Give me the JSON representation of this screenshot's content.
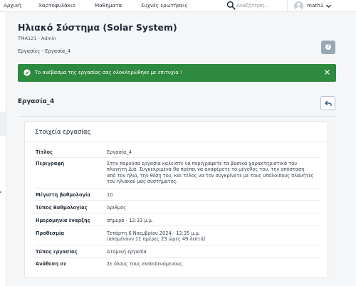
{
  "topnav": {
    "items": [
      "Αρχική",
      "Χαρτοφυλάκιο",
      "Μαθήματα",
      "Συχνές ερωτήσεις"
    ],
    "search_placeholder": "Αναζήτηση...",
    "username": "math1"
  },
  "header": {
    "title": "Ηλιακό Σύστημα (Solar System)",
    "course_sub": "TMA121 - Admin",
    "breadcrumb": "Εργασίες - Εργασία_4"
  },
  "alert": {
    "message": "Το ανέβασμα της εργασίας σας ολοκληρώθηκε με επιτυχία !",
    "color": "#2e8a3e"
  },
  "assignment": {
    "heading": "Εργασία_4"
  },
  "details": {
    "title": "Στοιχεία εργασίας",
    "rows": [
      {
        "label": "Τίτλος",
        "value": "Εργασία_4"
      },
      {
        "label": "Περιγραφή",
        "value_lines": [
          "Στην παρούσα εργασία καλείστε να περιγράψετε τα βασικά χαρακτηριστικά του",
          "πλανήτη Δία. Συγκεκριμένα θα πρέπει να αναφέρετε το μέγεθος του, την απόσταση",
          "από τον ήλιο, την θέση του, και τέλος να τον συγκρίνετε με τους υπόλοιπους πλανήτες",
          "του ηλιακού μας συστήματος."
        ]
      },
      {
        "label": "Μέγιστη βαθμολογία",
        "value": "10"
      },
      {
        "label": "Τύπος Βαθμολογίας",
        "value": "Αριθμός"
      },
      {
        "label": "Ημερομηνία έναρξης",
        "value": "σήμερα - 12:31 μ.μ."
      },
      {
        "label": "Προθεσμία",
        "value_lines": [
          "Τετάρτη 6 Νοεμβρίου 2024 - 12:35 μ.μ.",
          "(απομένουν 11 ημέρες 23 ώρες 49 λεπτά)"
        ]
      },
      {
        "label": "Τύπος εργασίας",
        "value": "Ατομική εργασία"
      },
      {
        "label": "Ανάθεση σε",
        "value": "Σε όλους τους εκπαιδευόμενους"
      }
    ]
  },
  "icons": {
    "search": "search-icon",
    "chevron": "chevron-down-icon",
    "help": "help-icon",
    "check": "check-circle-icon",
    "close": "close-icon",
    "back": "back-arrow-icon",
    "avatar": "user-avatar-icon"
  }
}
